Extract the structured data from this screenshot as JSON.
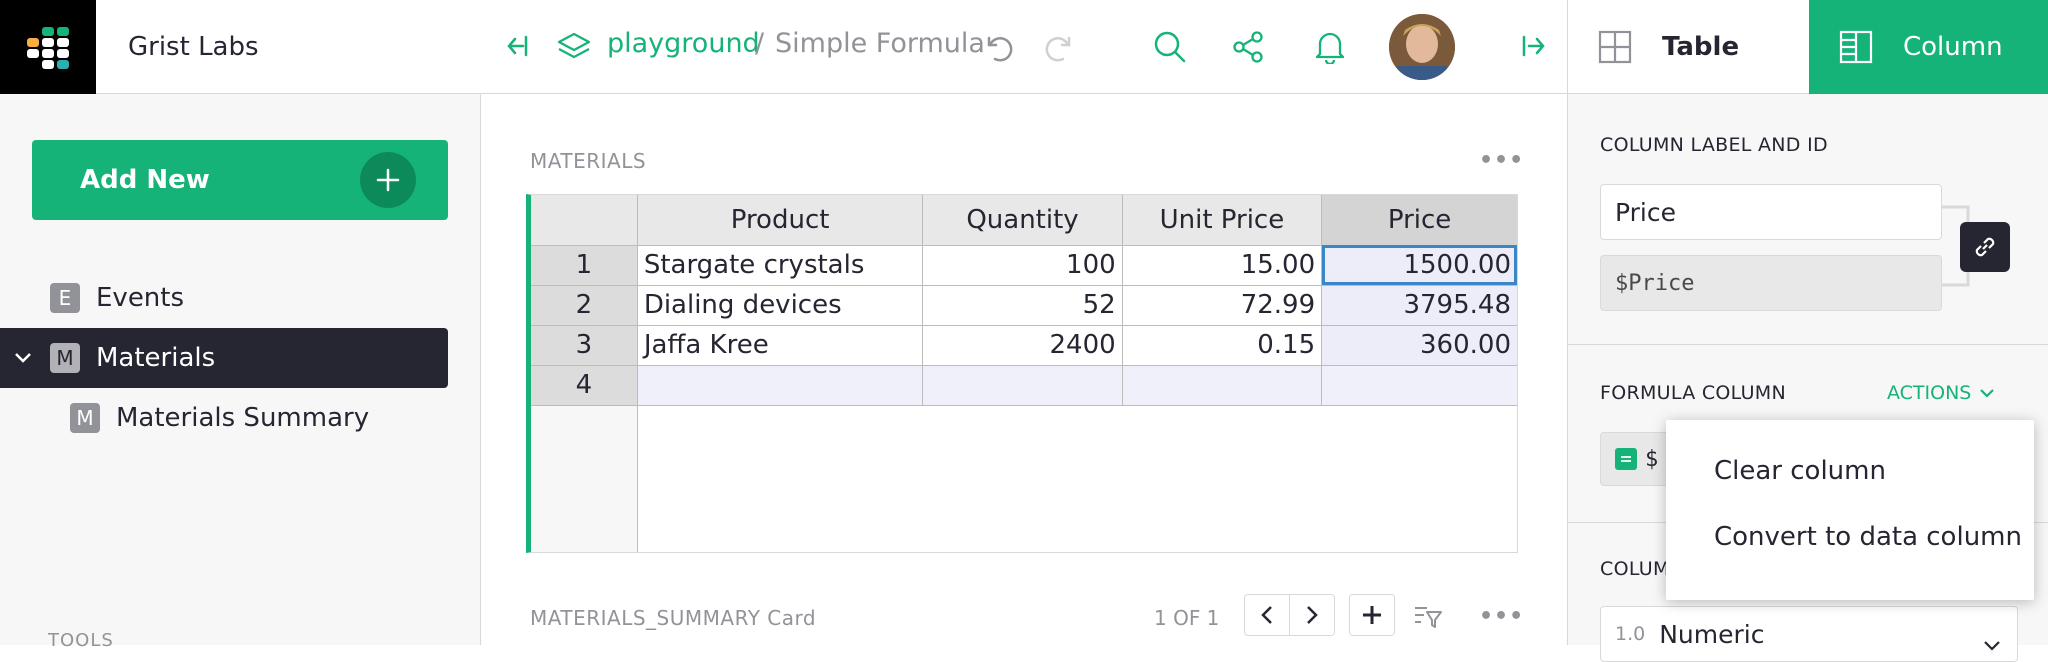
{
  "org": {
    "name": "Grist Labs"
  },
  "left_panel": {
    "add_new_label": "Add New",
    "pages": [
      {
        "badge": "E",
        "label": "Events"
      },
      {
        "badge": "M",
        "label": "Materials"
      },
      {
        "badge": "M",
        "label": "Materials Summary"
      }
    ],
    "tools_label": "TOOLS"
  },
  "topbar": {
    "workspace": "playground",
    "separator": "/",
    "doc_name": "Simple Formula"
  },
  "main": {
    "section1_title": "MATERIALS",
    "columns": [
      "Product",
      "Quantity",
      "Unit Price",
      "Price"
    ],
    "rows": [
      {
        "n": "1",
        "product": "Stargate crystals",
        "quantity": "100",
        "unit_price": "15.00",
        "price": "1500.00"
      },
      {
        "n": "2",
        "product": "Dialing devices",
        "quantity": "52",
        "unit_price": "72.99",
        "price": "3795.48"
      },
      {
        "n": "3",
        "product": "Jaffa Kree",
        "quantity": "2400",
        "unit_price": "0.15",
        "price": "360.00"
      }
    ],
    "new_row_number": "4",
    "section2_title": "MATERIALS_SUMMARY Card",
    "pager_text": "1 OF 1"
  },
  "right_panel": {
    "tab_table": "Table",
    "tab_column": "Column",
    "label_and_id_title": "COLUMN LABEL AND ID",
    "column_label": "Price",
    "column_id": "$Price",
    "formula_title": "FORMULA COLUMN",
    "actions_label": "ACTIONS",
    "formula_snippet": "$",
    "column_type_title": "COLUM",
    "type_prefix": "1.0",
    "type_value": "Numeric"
  },
  "actions_menu": {
    "items": [
      "Clear column",
      "Convert to data column"
    ]
  },
  "colors": {
    "accent": "#16b378",
    "dark": "#262633",
    "cursor": "#3b86c7"
  }
}
